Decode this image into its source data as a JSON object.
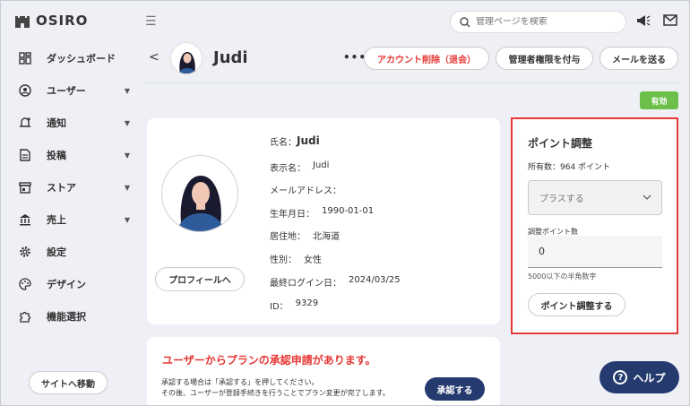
{
  "app": {
    "logo_text": "OSIRO"
  },
  "topbar": {
    "search_placeholder": "管理ページを検索"
  },
  "sidebar": {
    "items": [
      {
        "label": "ダッシュボード",
        "icon": "dashboard-icon"
      },
      {
        "label": "ユーザー",
        "icon": "user-icon",
        "has_sub": true
      },
      {
        "label": "通知",
        "icon": "bell-plus-icon",
        "has_sub": true
      },
      {
        "label": "投稿",
        "icon": "document-icon",
        "has_sub": true
      },
      {
        "label": "ストア",
        "icon": "store-icon",
        "has_sub": true
      },
      {
        "label": "売上",
        "icon": "bank-icon",
        "has_sub": true
      },
      {
        "label": "設定",
        "icon": "gear-icon"
      },
      {
        "label": "デザイン",
        "icon": "palette-icon"
      },
      {
        "label": "機能選択",
        "icon": "puzzle-icon"
      }
    ],
    "site_button": "サイトへ移動"
  },
  "header": {
    "name": "Judi",
    "more": "•••",
    "delete_account": "アカウント削除（退会）",
    "grant_admin": "管理者権限を付与",
    "send_mail": "メールを送る",
    "status": "有効"
  },
  "profile": {
    "button": "プロフィールへ",
    "fields": [
      {
        "label": "氏名：",
        "value": "Judi"
      },
      {
        "label": "表示名：",
        "value": "Judi"
      },
      {
        "label": "メールアドレス：",
        "value": ""
      },
      {
        "label": "生年月日：",
        "value": "1990-01-01"
      },
      {
        "label": "居住地：",
        "value": "北海道"
      },
      {
        "label": "性別：",
        "value": "女性"
      },
      {
        "label": "最終ログイン日：",
        "value": "2024/03/25"
      },
      {
        "label": "ID：",
        "value": "9329"
      }
    ]
  },
  "points": {
    "title": "ポイント調整",
    "balance": "所有数：964 ポイント",
    "select_value": "プラスする",
    "amount_label": "調整ポイント数",
    "amount_value": "0",
    "hint": "5000以下の半角数字",
    "submit": "ポイント調整する"
  },
  "approval": {
    "title": "ユーザーからプランの承認申請があります。",
    "desc1": "承認する場合は「承認する」を押してください。",
    "desc2": "その後、ユーザーが登録手続きを行うことでプラン変更が完了します。",
    "button": "承認する"
  },
  "help": {
    "label": "ヘルプ"
  },
  "colors": {
    "accent_red": "#e53935",
    "navy": "#253a6e",
    "status_green": "#6cc04a"
  }
}
